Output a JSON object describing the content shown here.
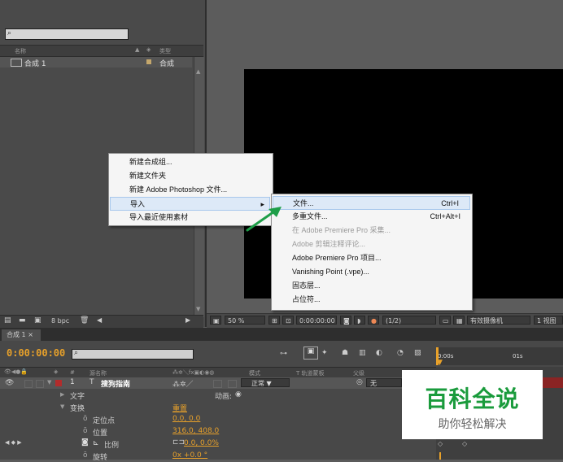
{
  "project": {
    "col_name": "名称",
    "col_type": "类型",
    "item": {
      "name": "合成 1",
      "type": "合成"
    },
    "bpc": "8 bpc"
  },
  "viewer": {
    "zoom": "50 %",
    "time": "0:00:00:00",
    "resolution": "(1/2)",
    "camera": "有效摄像机",
    "views": "1 视图"
  },
  "context_menu": {
    "items": [
      {
        "label": "新建合成组..."
      },
      {
        "label": "新建文件夹"
      },
      {
        "label": "新建 Adobe Photoshop 文件..."
      },
      {
        "label": "导入",
        "arrow": "▸"
      },
      {
        "label": "导入最近使用素材"
      }
    ]
  },
  "submenu": {
    "items": [
      {
        "label": "文件...",
        "shortcut": "Ctrl+I"
      },
      {
        "label": "多重文件...",
        "shortcut": "Ctrl+Alt+I"
      },
      {
        "label": "在 Adobe Premiere Pro 采集..."
      },
      {
        "label": "Adobe 剪辑注释评论..."
      },
      {
        "label": "Adobe Premiere Pro 项目..."
      },
      {
        "label": "Vanishing Point (.vpe)..."
      },
      {
        "label": "固态层..."
      },
      {
        "label": "占位符..."
      }
    ]
  },
  "timeline": {
    "tab": "合成 1",
    "timecode": "0:00:00:00",
    "hdr_source": "源名称",
    "hdr_mode": "模式",
    "hdr_trkmat": "T 轨道蒙板",
    "hdr_parent": "父级",
    "ruler_0": "0:00s",
    "ruler_1": "01s",
    "layer": {
      "num": "1",
      "name": "搜狗指南",
      "mode": "正常",
      "parent": "无"
    },
    "text_label": "文字",
    "animate_label": "动画:",
    "transform_label": "变换",
    "reset_label": "重置",
    "props": [
      {
        "name": "定位点",
        "value": "0.0, 0.0"
      },
      {
        "name": "位置",
        "value": "316.0, 408.0"
      },
      {
        "name": "比例",
        "value": "0.0, 0.0%"
      },
      {
        "name": "旋转",
        "value": "0x +0.0 °"
      }
    ]
  },
  "watermark": {
    "title": "百科全说",
    "subtitle": "助你轻松解决"
  },
  "colors": {
    "accent": "#e8a12a",
    "menu_bg": "#f5f5f5",
    "arrow": "#1e9e48",
    "layer_red": "#8a2424"
  }
}
